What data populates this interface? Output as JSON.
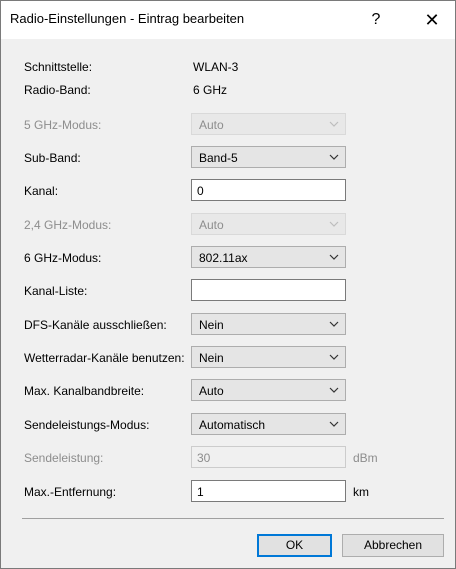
{
  "window": {
    "title": "Radio-Einstellungen - Eintrag bearbeiten",
    "help_glyph": "?",
    "close_glyph": "✕"
  },
  "fields": {
    "schnittstelle": {
      "label": "Schnittstelle:",
      "value": "WLAN-3"
    },
    "radio_band": {
      "label": "Radio-Band:",
      "value": "6 GHz"
    },
    "modus_5ghz": {
      "label": "5 GHz-Modus:",
      "value": "Auto"
    },
    "sub_band": {
      "label": "Sub-Band:",
      "value": "Band-5"
    },
    "kanal": {
      "label": "Kanal:",
      "value": "0"
    },
    "modus_24ghz": {
      "label": "2,4 GHz-Modus:",
      "value": "Auto"
    },
    "modus_6ghz": {
      "label": "6 GHz-Modus:",
      "value": "802.11ax"
    },
    "kanal_liste": {
      "label": "Kanal-Liste:",
      "value": ""
    },
    "dfs": {
      "label": "DFS-Kanäle ausschließen:",
      "value": "Nein"
    },
    "wetterradar": {
      "label": "Wetterradar-Kanäle benutzen:",
      "value": "Nein"
    },
    "max_bandbreite": {
      "label": "Max. Kanalbandbreite:",
      "value": "Auto"
    },
    "sendeleistungs_modus": {
      "label": "Sendeleistungs-Modus:",
      "value": "Automatisch"
    },
    "sendeleistung": {
      "label": "Sendeleistung:",
      "value": "30",
      "unit": "dBm"
    },
    "max_entfernung": {
      "label": "Max.-Entfernung:",
      "value": "1",
      "unit": "km"
    }
  },
  "buttons": {
    "ok": "OK",
    "cancel": "Abbrechen"
  }
}
